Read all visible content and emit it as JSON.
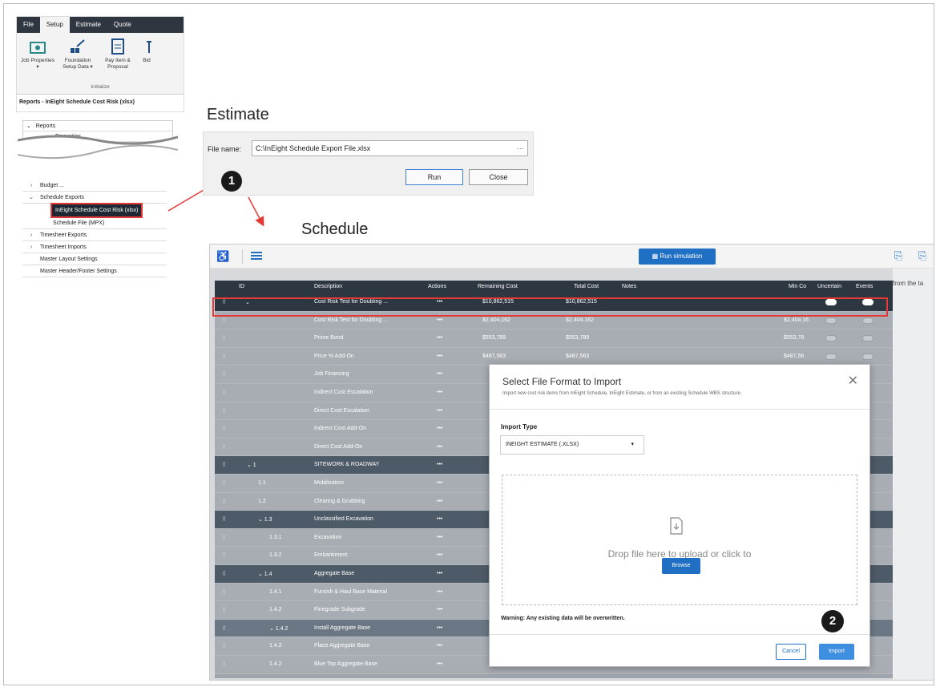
{
  "ribbon": {
    "tabs": [
      "File",
      "Setup",
      "Estimate",
      "Quote"
    ],
    "buttons": [
      {
        "label": "Job Properties\n▾",
        "icon": "job-properties-icon"
      },
      {
        "label": "Foundation\nSetup Data ▾",
        "icon": "foundation-icon"
      },
      {
        "label": "Pay Item &\nProposal",
        "icon": "pay-item-icon"
      },
      {
        "label": "Bid",
        "icon": "bid-icon"
      }
    ],
    "group_label": "Initialize",
    "report_title": "Reports - InEight Schedule Cost Risk (xlsx)"
  },
  "tree_top": [
    "Reports",
    "Properties"
  ],
  "tree": [
    {
      "exp": "›",
      "label": "Budget ..."
    },
    {
      "exp": "⌄",
      "label": "Schedule Exports"
    },
    {
      "exp": "",
      "label": "InEight Schedule Cost Risk (xlsx)",
      "selected": true
    },
    {
      "exp": "",
      "label": "Schedule File (MPX)"
    },
    {
      "exp": "›",
      "label": "Timesheet Exports"
    },
    {
      "exp": "›",
      "label": "Timesheet Imports"
    },
    {
      "exp": "",
      "label": "Master Layout Settings"
    },
    {
      "exp": "",
      "label": "Master Header/Footer Settings"
    }
  ],
  "estimate": {
    "title": "Estimate",
    "file_label": "File name:",
    "file_value": "C:\\InEight Schedule Export File.xlsx",
    "dots": "···",
    "run": "Run",
    "close": "Close"
  },
  "badges": {
    "one": "1",
    "two": "2"
  },
  "schedule": {
    "title": "Schedule",
    "run_simulation": "Run simulation",
    "side_text": "from the ta",
    "headers": {
      "id": "ID",
      "description": "Description",
      "actions": "Actions",
      "remaining": "Remaining Cost",
      "total": "Total Cost",
      "notes": "Notes",
      "min": "Min Co",
      "uncertain": "Uncertain",
      "events": "Events"
    },
    "rows": [
      {
        "style": "top",
        "id": "⌄",
        "desc": "Cost Risk Test for Doubling ...",
        "act": "•••",
        "rem": "$10,862,515",
        "tot": "$10,862,515",
        "min": "",
        "tog": "on"
      },
      {
        "style": "plain",
        "id": "",
        "desc": "Cost Risk Test for Doubling ...",
        "act": "•••",
        "rem": "$2,404,162",
        "tot": "$2,404,162",
        "min": "$2,404,16",
        "tog": "off"
      },
      {
        "style": "plain",
        "id": "",
        "desc": "Prime Bond",
        "act": "•••",
        "rem": "$553,789",
        "tot": "$553,789",
        "min": "$553,78",
        "tog": "off"
      },
      {
        "style": "plain",
        "id": "",
        "desc": "Price % Add-On",
        "act": "•••",
        "rem": "$487,563",
        "tot": "$487,563",
        "min": "$487,56",
        "tog": "off"
      },
      {
        "style": "plain",
        "id": "",
        "desc": "Job Financing",
        "act": "•••",
        "rem": "",
        "tot": "",
        "min": "",
        "tog": ""
      },
      {
        "style": "plain",
        "id": "",
        "desc": "Indirect Cost Escalation",
        "act": "•••",
        "rem": "",
        "tot": "",
        "min": "",
        "tog": ""
      },
      {
        "style": "plain",
        "id": "",
        "desc": "Direct Cost Escalation",
        "act": "•••",
        "rem": "",
        "tot": "",
        "min": "",
        "tog": ""
      },
      {
        "style": "plain",
        "id": "",
        "desc": "Indirect Cost Add-On",
        "act": "•••",
        "rem": "",
        "tot": "",
        "min": "",
        "tog": ""
      },
      {
        "style": "plain",
        "id": "",
        "desc": "Direct Cost Add-On",
        "act": "•••",
        "rem": "",
        "tot": "",
        "min": "",
        "tog": ""
      },
      {
        "style": "grp",
        "id": "⌄ 1",
        "desc": "SITEWORK & ROADWAY",
        "act": "•••",
        "rem": "",
        "tot": "",
        "min": "",
        "tog": ""
      },
      {
        "style": "plain",
        "id": "1.1",
        "desc": "Mobilization",
        "act": "•••",
        "rem": "",
        "tot": "",
        "min": "",
        "tog": ""
      },
      {
        "style": "plain",
        "id": "1.2",
        "desc": "Clearing & Grubbing",
        "act": "•••",
        "rem": "",
        "tot": "",
        "min": "",
        "tog": ""
      },
      {
        "style": "grp",
        "id": "⌄ 1.3",
        "desc": "Unclassified Excavation",
        "act": "•••",
        "rem": "",
        "tot": "",
        "min": "",
        "tog": ""
      },
      {
        "style": "plain",
        "id": "1.3.1",
        "desc": "Excavation",
        "act": "•••",
        "rem": "",
        "tot": "",
        "min": "",
        "tog": ""
      },
      {
        "style": "plain",
        "id": "1.3.2",
        "desc": "Embankment",
        "act": "•••",
        "rem": "",
        "tot": "",
        "min": "",
        "tog": ""
      },
      {
        "style": "grp",
        "id": "⌄ 1.4",
        "desc": "Aggregate Base",
        "act": "•••",
        "rem": "",
        "tot": "",
        "min": "",
        "tog": ""
      },
      {
        "style": "plain",
        "id": "1.4.1",
        "desc": "Furnish & Haul Base Material",
        "act": "•••",
        "rem": "",
        "tot": "",
        "min": "",
        "tog": ""
      },
      {
        "style": "plain",
        "id": "1.4.2",
        "desc": "Finegrade Subgrade",
        "act": "•••",
        "rem": "",
        "tot": "",
        "min": "",
        "tog": ""
      },
      {
        "style": "sub",
        "id": "⌄ 1.4.2",
        "desc": "Install Aggregate Base",
        "act": "•••",
        "rem": "",
        "tot": "",
        "min": "",
        "tog": ""
      },
      {
        "style": "plain",
        "id": "1.4.2",
        "desc": "Place Aggregate Base",
        "act": "•••",
        "rem": "",
        "tot": "",
        "min": "",
        "tog": ""
      },
      {
        "style": "plain",
        "id": "1.4.2",
        "desc": "Blue Top Aggregate Base",
        "act": "•••",
        "rem": "",
        "tot": "",
        "min": "",
        "tog": ""
      }
    ]
  },
  "modal": {
    "title": "Select File Format to Import",
    "subtitle": "Import new cost risk items from InEight Schedule, InEight Estimate, or from an existing Schedule WBS structure.",
    "close": "✕",
    "import_type_label": "Import Type",
    "import_type_value": "INEIGHT ESTIMATE (.XLSX)",
    "drop_text": "Drop file here to upload or click to",
    "browse": "Browse",
    "warning": "Warning: Any existing data will be overwritten.",
    "cancel": "Cancel",
    "import": "Import"
  },
  "colors": {
    "accent": "#1f6fc4",
    "highlight": "#e53935",
    "header": "#2d3742"
  }
}
